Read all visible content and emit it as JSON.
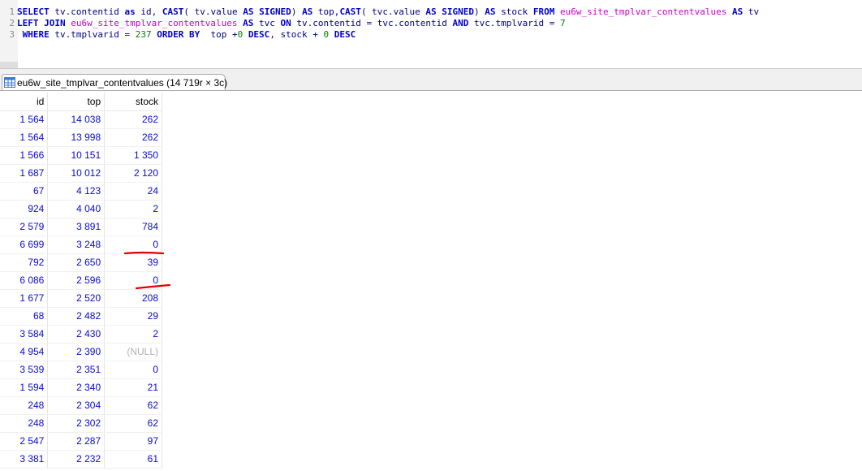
{
  "editor": {
    "lines": [
      {
        "num": "1",
        "tokens": [
          {
            "t": "SELECT",
            "c": "kw"
          },
          {
            "t": " tv.contentid ",
            "c": "plain"
          },
          {
            "t": "as",
            "c": "kw"
          },
          {
            "t": " id, ",
            "c": "plain"
          },
          {
            "t": "CAST",
            "c": "fn"
          },
          {
            "t": "( tv.value ",
            "c": "plain"
          },
          {
            "t": "AS SIGNED",
            "c": "kw"
          },
          {
            "t": ") ",
            "c": "plain"
          },
          {
            "t": "AS",
            "c": "kw"
          },
          {
            "t": " top,",
            "c": "plain"
          },
          {
            "t": "CAST",
            "c": "fn"
          },
          {
            "t": "( tvc.value ",
            "c": "plain"
          },
          {
            "t": "AS SIGNED",
            "c": "kw"
          },
          {
            "t": ") ",
            "c": "plain"
          },
          {
            "t": "AS",
            "c": "kw"
          },
          {
            "t": " stock ",
            "c": "plain"
          },
          {
            "t": "FROM",
            "c": "kw"
          },
          {
            "t": " ",
            "c": "plain"
          },
          {
            "t": "eu6w_site_tmplvar_contentvalues",
            "c": "tbl"
          },
          {
            "t": " ",
            "c": "plain"
          },
          {
            "t": "AS",
            "c": "kw"
          },
          {
            "t": " tv",
            "c": "plain"
          }
        ]
      },
      {
        "num": "2",
        "tokens": [
          {
            "t": "LEFT JOIN",
            "c": "kw"
          },
          {
            "t": " ",
            "c": "plain"
          },
          {
            "t": "eu6w_site_tmplvar_contentvalues",
            "c": "tbl"
          },
          {
            "t": " ",
            "c": "plain"
          },
          {
            "t": "AS",
            "c": "kw"
          },
          {
            "t": " tvc ",
            "c": "plain"
          },
          {
            "t": "ON",
            "c": "kw"
          },
          {
            "t": " tv.contentid = tvc.contentid ",
            "c": "plain"
          },
          {
            "t": "AND",
            "c": "kw"
          },
          {
            "t": " tvc.tmplvarid = ",
            "c": "plain"
          },
          {
            "t": "7",
            "c": "num"
          }
        ]
      },
      {
        "num": "3",
        "tokens": [
          {
            "t": " ",
            "c": "plain"
          },
          {
            "t": "WHERE",
            "c": "kw"
          },
          {
            "t": " tv.tmplvarid = ",
            "c": "plain"
          },
          {
            "t": "237",
            "c": "num"
          },
          {
            "t": " ",
            "c": "plain"
          },
          {
            "t": "ORDER BY",
            "c": "kw"
          },
          {
            "t": "  top +",
            "c": "plain"
          },
          {
            "t": "0",
            "c": "num"
          },
          {
            "t": " ",
            "c": "plain"
          },
          {
            "t": "DESC",
            "c": "kw"
          },
          {
            "t": ", stock + ",
            "c": "plain"
          },
          {
            "t": "0",
            "c": "num"
          },
          {
            "t": " ",
            "c": "plain"
          },
          {
            "t": "DESC",
            "c": "kw"
          }
        ]
      }
    ]
  },
  "tab": {
    "label": "eu6w_site_tmplvar_contentvalues (14 719r × 3c)",
    "icon": "table-grid-icon"
  },
  "grid": {
    "columns": [
      "id",
      "top",
      "stock"
    ],
    "rows": [
      [
        "1 564",
        "14 038",
        "262"
      ],
      [
        "1 564",
        "13 998",
        "262"
      ],
      [
        "1 566",
        "10 151",
        "1 350"
      ],
      [
        "1 687",
        "10 012",
        "2 120"
      ],
      [
        "67",
        "4 123",
        "24"
      ],
      [
        "924",
        "4 040",
        "2"
      ],
      [
        "2 579",
        "3 891",
        "784"
      ],
      [
        "6 699",
        "3 248",
        "0"
      ],
      [
        "792",
        "2 650",
        "39"
      ],
      [
        "6 086",
        "2 596",
        "0"
      ],
      [
        "1 677",
        "2 520",
        "208"
      ],
      [
        "68",
        "2 482",
        "29"
      ],
      [
        "3 584",
        "2 430",
        "2"
      ],
      [
        "4 954",
        "2 390",
        "(NULL)"
      ],
      [
        "3 539",
        "2 351",
        "0"
      ],
      [
        "1 594",
        "2 340",
        "21"
      ],
      [
        "248",
        "2 304",
        "62"
      ],
      [
        "248",
        "2 302",
        "62"
      ],
      [
        "2 547",
        "2 287",
        "97"
      ],
      [
        "3 381",
        "2 232",
        "61"
      ]
    ]
  },
  "colors": {
    "keyword": "#0000cc",
    "identifier": "#000080",
    "table_name": "#cc00cc",
    "number": "#008000",
    "cell_value": "#0a0ad0",
    "null_value": "#b0b0b0",
    "annotation": "#e00000"
  }
}
